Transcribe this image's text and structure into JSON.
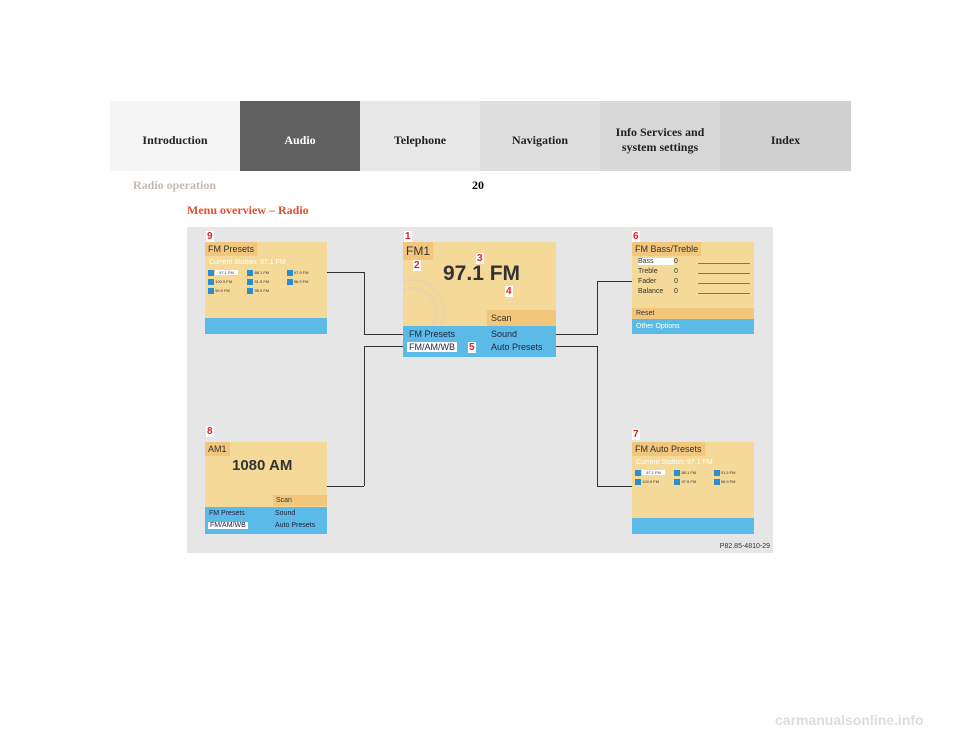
{
  "tabs": [
    {
      "label": "Introduction",
      "bg": "#f5f5f5"
    },
    {
      "label": "Audio",
      "bg": "#606060"
    },
    {
      "label": "Telephone",
      "bg": "#e8e8e8"
    },
    {
      "label": "Navigation",
      "bg": "#dedede"
    },
    {
      "label": "Info Services and system settings",
      "bg": "#d7d7d7"
    },
    {
      "label": "Index",
      "bg": "#d0d0d0"
    }
  ],
  "header": {
    "section": "Radio operation",
    "page": "20"
  },
  "heading": "Menu overview – Radio",
  "figure": {
    "ref": "P82.85-4810-29",
    "main": {
      "num": "1",
      "band": "FM1",
      "freq": "97.1 FM",
      "scan": "Scan",
      "menu": [
        "FM Presets",
        "Sound",
        "FM/AM/WB",
        "Auto Presets"
      ],
      "callouts": [
        "2",
        "3",
        "4",
        "5"
      ]
    },
    "presets": {
      "num": "9",
      "title": "FM Presets",
      "current": "Current Station: 97.1 FM",
      "stations": [
        "97.1 FM",
        "88.1 FM",
        "97.9 FM",
        "100.9 FM",
        "91.5 FM",
        "96.9 FM",
        "90.9 FM",
        "95.9 FM"
      ]
    },
    "sound": {
      "num": "6",
      "title": "FM Bass/Treble",
      "rows": [
        {
          "label": "Bass",
          "value": "0"
        },
        {
          "label": "Treble",
          "value": "0"
        },
        {
          "label": "Fader",
          "value": "0"
        },
        {
          "label": "Balance",
          "value": "0"
        }
      ],
      "reset": "Reset",
      "other": "Other Options"
    },
    "am": {
      "num": "8",
      "band": "AM1",
      "freq": "1080 AM",
      "scan": "Scan",
      "menu": [
        "FM Presets",
        "Sound",
        "FM/AM/WB",
        "Auto Presets"
      ]
    },
    "auto": {
      "num": "7",
      "title": "FM Auto Presets",
      "current": "Current Station: 97.1 FM",
      "stations": [
        "97.1 FM",
        "88.1 FM",
        "91.5 FM",
        "100.9 FM",
        "97.5 FM",
        "96.9 FM"
      ]
    }
  },
  "watermark": "carmanualsonline.info"
}
